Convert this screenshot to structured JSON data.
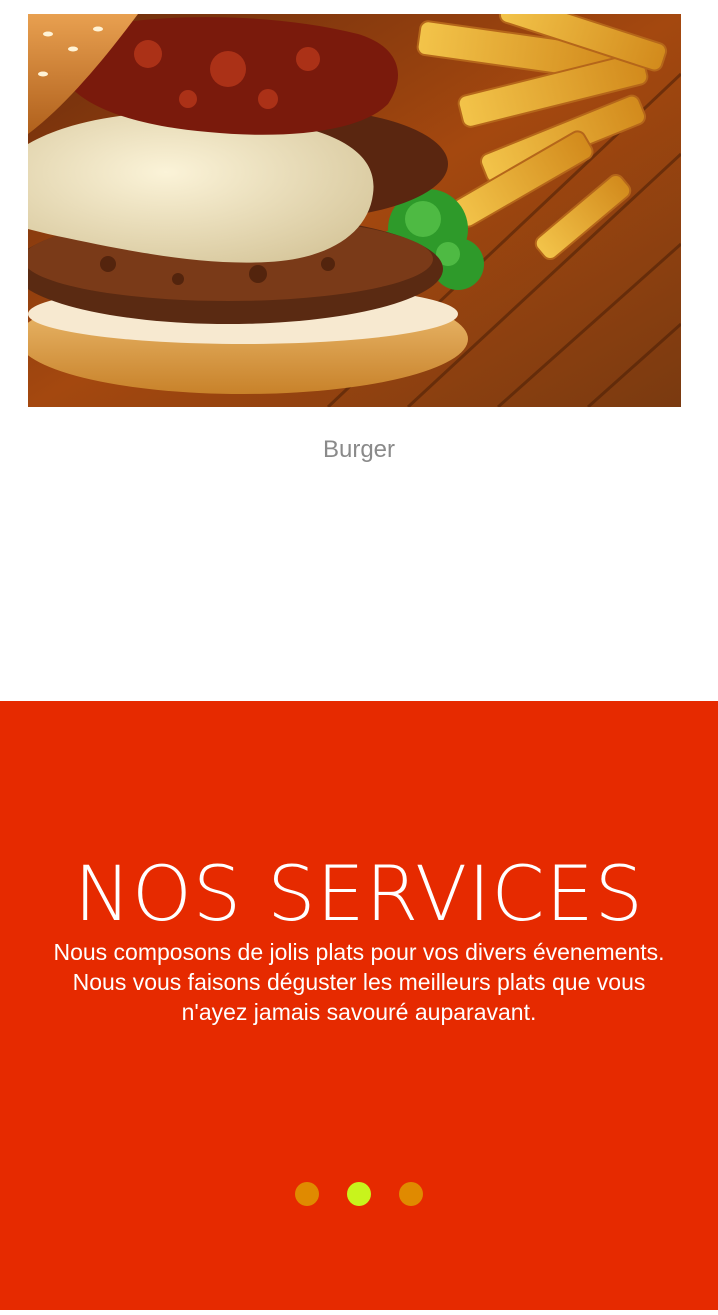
{
  "carousel": {
    "image_alt": "Burger",
    "caption": "Burger"
  },
  "services": {
    "title": "NOS SERVICES",
    "description": "Nous composons de jolis plats pour vos divers évenements. Nous vous faisons déguster les meilleurs plats que vous n'ayez jamais savouré auparavant.",
    "background_color": "#e62a00",
    "pagination": {
      "total": 3,
      "active_index": 1,
      "dot_color": "#e08a00",
      "active_dot_color": "#c8f41c"
    }
  }
}
